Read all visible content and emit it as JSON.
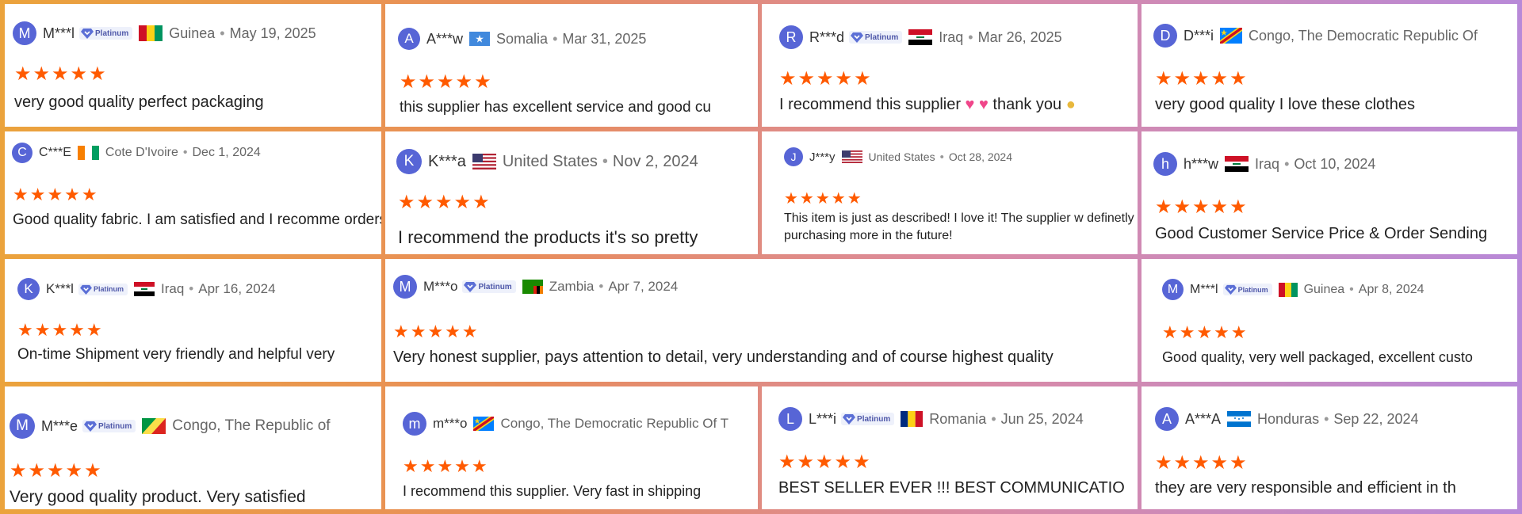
{
  "badge_label": "Platinum",
  "colors": {
    "avatar": "#5765d6",
    "star": "#ff5a00",
    "badge_bg": "#eef1fb"
  },
  "reviews": [
    {
      "id": "r1",
      "initial": "M",
      "name": "M***l",
      "platinum": true,
      "flag": "guinea",
      "country": "Guinea",
      "date": "May 19, 2025",
      "rating": 5,
      "text": "very good quality perfect packaging"
    },
    {
      "id": "r2",
      "initial": "A",
      "name": "A***w",
      "platinum": false,
      "flag": "somalia",
      "country": "Somalia",
      "date": "Mar 31, 2025",
      "rating": 5,
      "text": "this supplier has excellent service and good cu"
    },
    {
      "id": "r3",
      "initial": "R",
      "name": "R***d",
      "platinum": true,
      "flag": "iraq",
      "country": "Iraq",
      "date": "Mar 26, 2025",
      "rating": 5,
      "text_a": "I recommend this supplier",
      "text_b": "thank you"
    },
    {
      "id": "r4",
      "initial": "D",
      "name": "D***i",
      "platinum": false,
      "flag": "drc",
      "country": "Congo, The Democratic Republic Of",
      "date": "",
      "rating": 5,
      "text": "very good quality I love these clothes"
    },
    {
      "id": "r5",
      "initial": "C",
      "name": "C***E",
      "platinum": false,
      "flag": "ivorycoast",
      "country": "Cote D'Ivoire",
      "date": "Dec 1, 2024",
      "rating": 5,
      "text": "Good quality fabric. I am satisfied and I recomme orders."
    },
    {
      "id": "r6",
      "initial": "K",
      "name": "K***a",
      "platinum": false,
      "flag": "usa",
      "country": "United States",
      "date": "Nov 2, 2024",
      "rating": 5,
      "text": "I recommend the products it's so pretty"
    },
    {
      "id": "r7",
      "initial": "J",
      "name": "J***y",
      "platinum": false,
      "flag": "usa",
      "country": "United States",
      "date": "Oct 28, 2024",
      "rating": 5,
      "text": "This item is just as described!  I love it! The supplier w definetly be purchasing more in the future!"
    },
    {
      "id": "r8",
      "initial": "h",
      "name": "h***w",
      "platinum": false,
      "flag": "iraq",
      "country": "Iraq",
      "date": "Oct 10, 2024",
      "rating": 5,
      "text": "Good Customer Service Price & Order Sending"
    },
    {
      "id": "r9",
      "initial": "K",
      "name": "K***l",
      "platinum": true,
      "flag": "iraq",
      "country": "Iraq",
      "date": "Apr 16, 2024",
      "rating": 5,
      "text": "On-time Shipment very friendly and helpful very"
    },
    {
      "id": "r10",
      "initial": "M",
      "name": "M***o",
      "platinum": true,
      "flag": "zambia",
      "country": "Zambia",
      "date": "Apr 7, 2024",
      "rating": 5,
      "text": "Very honest supplier, pays attention to detail, very understanding and of course highest quality"
    },
    {
      "id": "r11",
      "initial": "M",
      "name": "M***l",
      "platinum": true,
      "flag": "guinea",
      "country": "Guinea",
      "date": "Apr 8, 2024",
      "rating": 5,
      "text": "Good quality, very well packaged, excellent custo"
    },
    {
      "id": "r12",
      "initial": "M",
      "name": "M***e",
      "platinum": true,
      "flag": "congo",
      "country": "Congo, The Republic of",
      "date": "",
      "rating": 5,
      "text": "Very good quality product. Very satisfied"
    },
    {
      "id": "r13",
      "initial": "m",
      "name": "m***o",
      "platinum": false,
      "flag": "drc",
      "country": "Congo, The Democratic Republic Of T",
      "date": "",
      "rating": 5,
      "text": "I recommend this supplier. Very fast in shipping"
    },
    {
      "id": "r14",
      "initial": "L",
      "name": "L***i",
      "platinum": true,
      "flag": "romania",
      "country": "Romania",
      "date": "Jun 25, 2024",
      "rating": 5,
      "text": "BEST SELLER EVER !!! BEST COMMUNICATIO"
    },
    {
      "id": "r15",
      "initial": "A",
      "name": "A***A",
      "platinum": false,
      "flag": "honduras",
      "country": "Honduras",
      "date": "Sep 22, 2024",
      "rating": 5,
      "text": "they are very responsible and efficient in th"
    }
  ]
}
